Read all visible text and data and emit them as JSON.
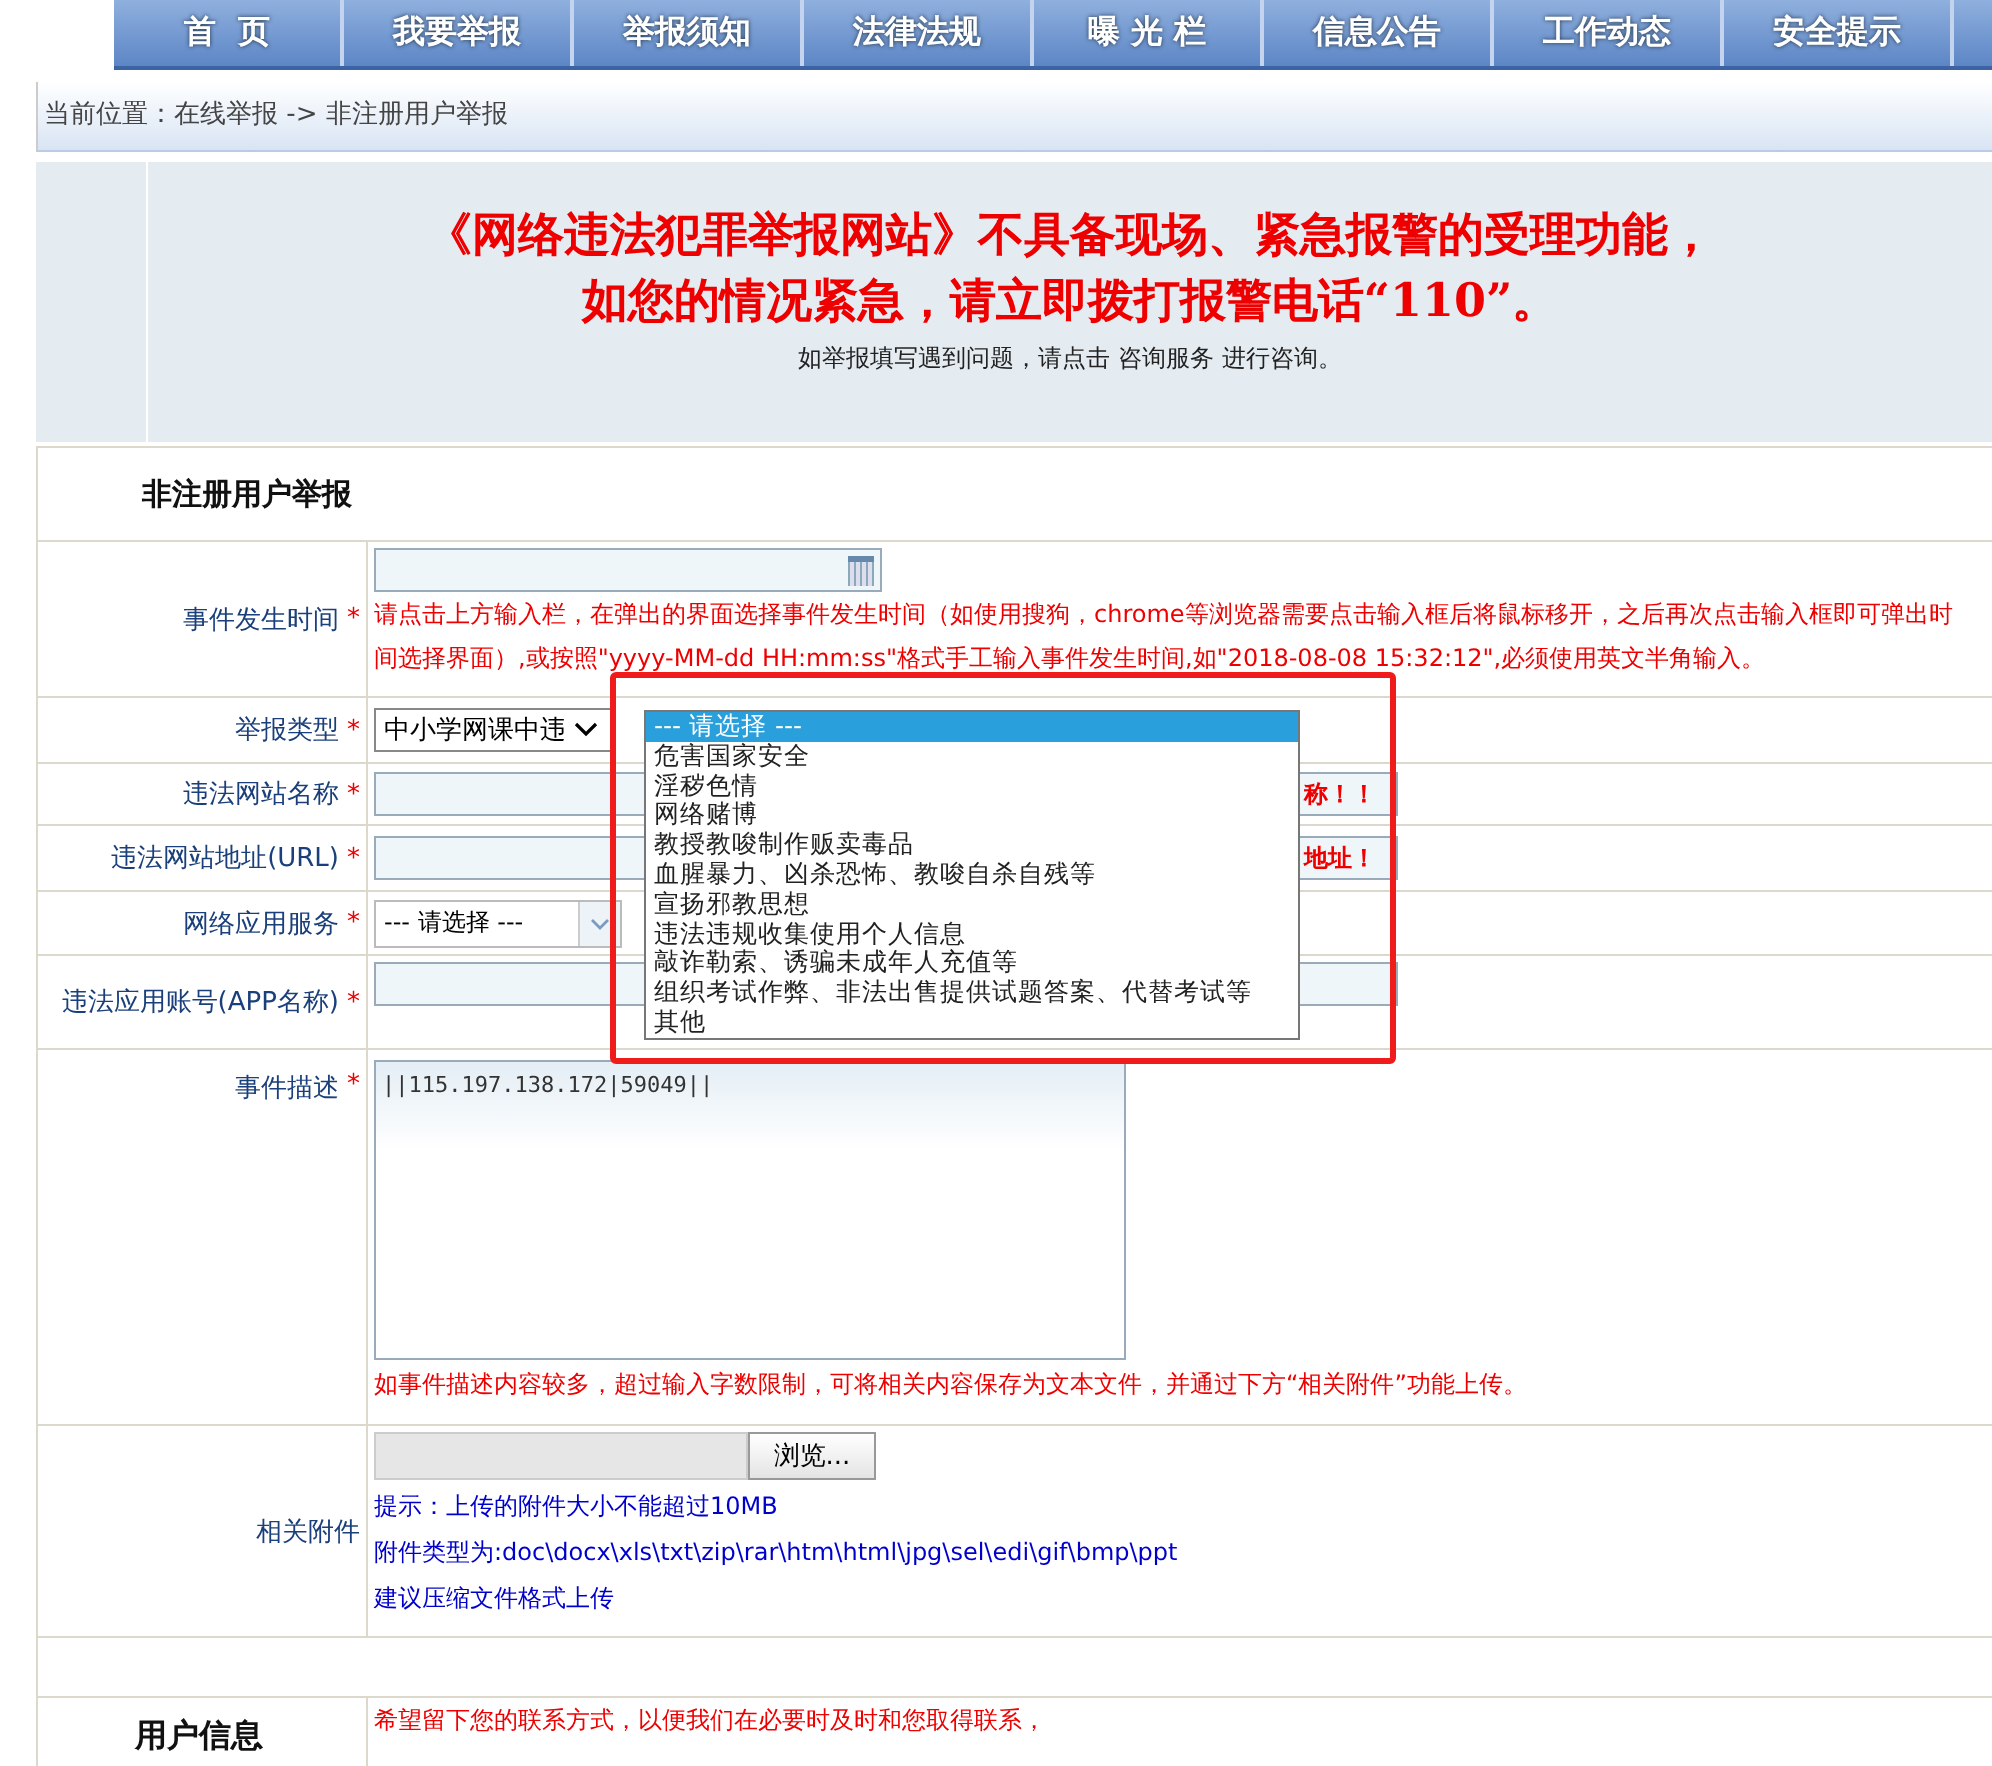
{
  "nav": [
    {
      "label": "首  页"
    },
    {
      "label": "我要举报"
    },
    {
      "label": "举报须知"
    },
    {
      "label": "法律法规"
    },
    {
      "label": "曝 光 栏"
    },
    {
      "label": "信息公告"
    },
    {
      "label": "工作动态"
    },
    {
      "label": "安全提示"
    }
  ],
  "breadcrumb": "当前位置：在线举报  -> 非注册用户举报",
  "notice": {
    "line1": "《网络违法犯罪举报网站》不具备现场、紧急报警的受理功能，",
    "line2": "如您的情况紧急，请立即拨打报警电话“110”。",
    "help_before": "如举报填写遇到问题，请点击",
    "help_link": "咨询服务",
    "help_after": "进行咨询。"
  },
  "form_title": "非注册用户举报",
  "fields": {
    "time": {
      "label": "事件发生时间",
      "mark": "*",
      "hint": "请点击上方输入栏，在弹出的界面选择事件发生时间（如使用搜狗，chrome等浏览器需要点击输入框后将鼠标移开，之后再次点击输入框即可弹出时间选择界面）,或按照\"yyyy-MM-dd HH:mm:ss\"格式手工输入事件发生时间,如\"2018-08-08 15:32:12\",必须使用英文半角输入。"
    },
    "type": {
      "label": "举报类型",
      "mark": "*",
      "value": "中小学网课中违"
    },
    "site_name": {
      "label": "违法网站名称",
      "mark": "*",
      "hint": "称！！"
    },
    "site_url": {
      "label": "违法网站地址(URL)",
      "mark": "*",
      "hint": "地址！"
    },
    "service": {
      "label": "网络应用服务",
      "mark": "*",
      "value": "--- 请选择 ---"
    },
    "app": {
      "label": "违法应用账号(APP名称)",
      "mark": "*"
    },
    "desc": {
      "label": "事件描述",
      "mark": "*",
      "value": "||115.197.138.172|59049||",
      "hint": "如事件描述内容较多，超过输入字数限制，可将相关内容保存为文本文件，并通过下方“相关附件”功能上传。"
    },
    "attach": {
      "label": "相关附件",
      "button": "浏览...",
      "notes": [
        "提示：上传的附件大小不能超过10MB",
        "附件类型为:doc\\docx\\xls\\txt\\zip\\rar\\htm\\html\\jpg\\sel\\edi\\gif\\bmp\\ppt",
        "建议压缩文件格式上传"
      ]
    }
  },
  "dropdown": [
    {
      "label": "--- 请选择 ---",
      "selected": true
    },
    {
      "label": "危害国家安全",
      "selected": false
    },
    {
      "label": "淫秽色情",
      "selected": false
    },
    {
      "label": "网络赌博",
      "selected": false
    },
    {
      "label": "教授教唆制作贩卖毒品",
      "selected": false
    },
    {
      "label": "血腥暴力、凶杀恐怖、教唆自杀自残等",
      "selected": false
    },
    {
      "label": "宣扬邪教思想",
      "selected": false
    },
    {
      "label": "违法违规收集使用个人信息",
      "selected": false
    },
    {
      "label": "敲诈勒索、诱骗未成年人充值等",
      "selected": false
    },
    {
      "label": "组织考试作弊、非法出售提供试题答案、代替考试等",
      "selected": false
    },
    {
      "label": "其他",
      "selected": false
    }
  ],
  "user_info": {
    "title": "用户信息",
    "hint": "希望留下您的联系方式，以便我们在必要时及时和您取得联系，"
  }
}
